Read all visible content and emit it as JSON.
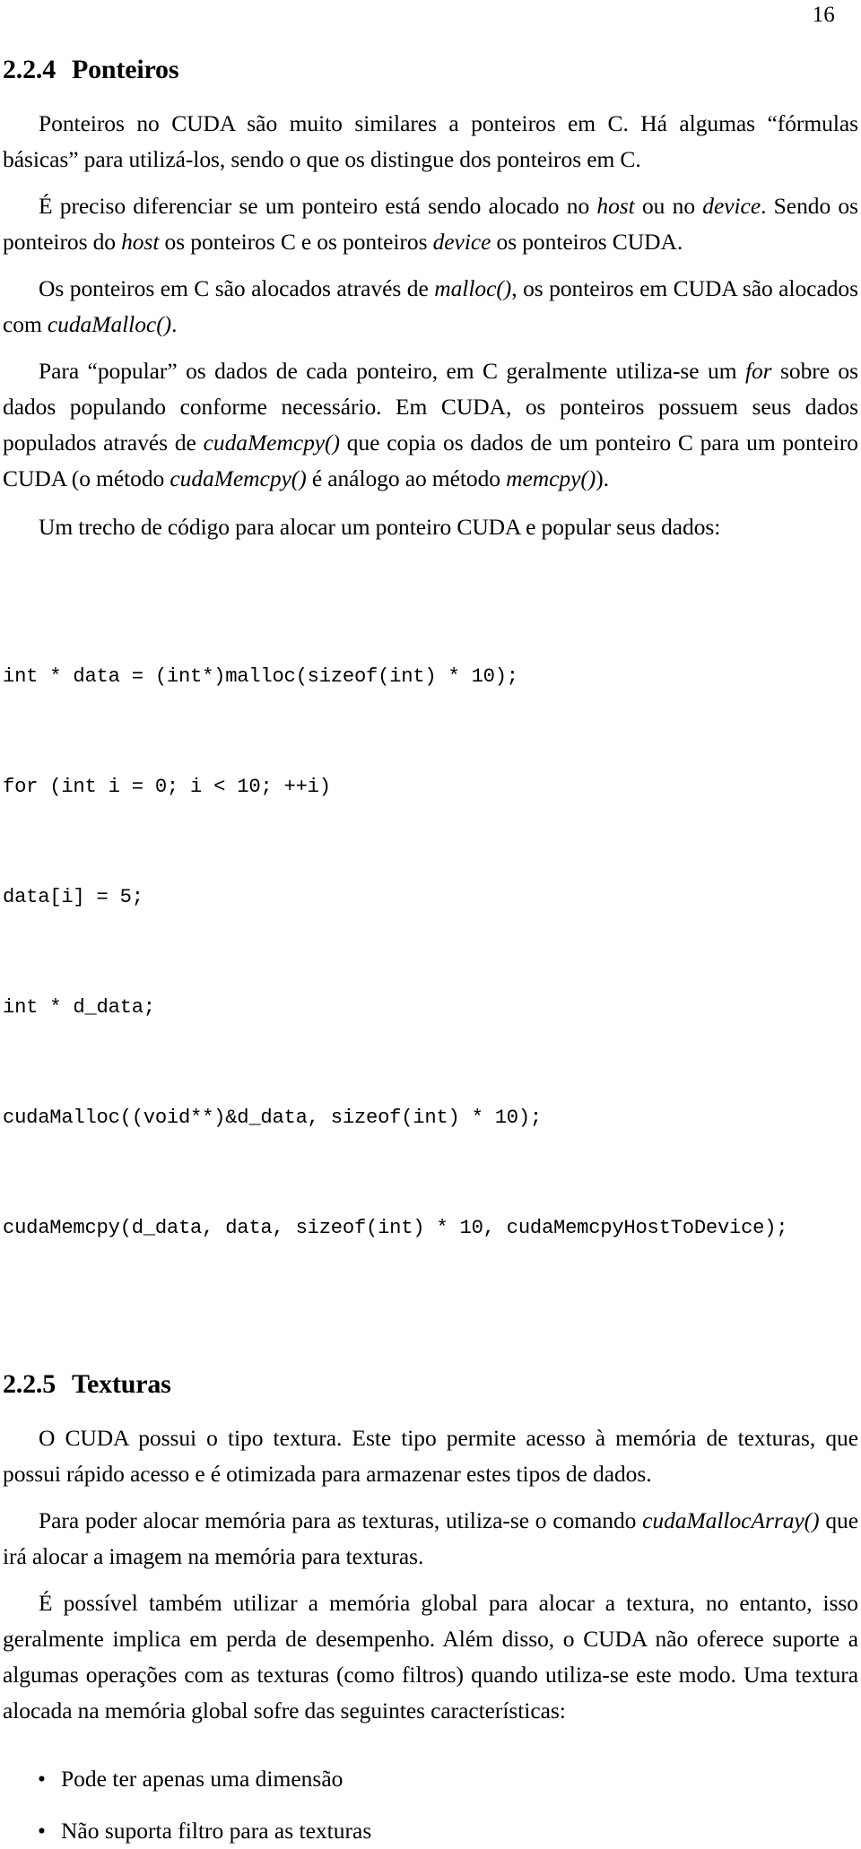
{
  "page": {
    "folio": "16"
  },
  "sections": [
    {
      "number": "2.2.4",
      "title": "Ponteiros"
    },
    {
      "number": "2.2.5",
      "title": "Texturas"
    }
  ],
  "paragraphs": {
    "p1": {
      "a": "Ponteiros no CUDA são muito similares a ponteiros em C. Há algumas “fórmulas básicas” para utilizá-los, sendo o que os distingue dos ponteiros em C."
    },
    "p2": {
      "a": "É preciso diferenciar se um ponteiro está sendo alocado no ",
      "i1": "host",
      "b": " ou no ",
      "i2": "device",
      "c": ". Sendo os ponteiros do ",
      "i3": "host",
      "d": " os ponteiros C e os ponteiros ",
      "i4": "device",
      "e": " os ponteiros CUDA."
    },
    "p3": {
      "a": "Os ponteiros em C são alocados através de ",
      "i1": "malloc()",
      "b": ", os ponteiros em CUDA são alocados com ",
      "i2": "cudaMalloc()",
      "c": "."
    },
    "p4": {
      "a": "Para “popular” os dados de cada ponteiro, em C geralmente utiliza-se um ",
      "i1": "for",
      "b": " sobre os dados populando conforme necessário. Em CUDA, os ponteiros possuem seus dados populados através de ",
      "i2": "cudaMemcpy()",
      "c": " que copia os dados de um ponteiro C para um ponteiro CUDA (o método ",
      "i3": "cudaMemcpy()",
      "d": " é análogo ao método ",
      "i4": "memcpy()",
      "e": ")."
    },
    "p5": {
      "a": "Um trecho de código para alocar um ponteiro CUDA e popular seus dados:"
    },
    "p6": {
      "a": "O CUDA possui o tipo textura. Este tipo permite acesso à memória de texturas, que possui rápido acesso e é otimizada para armazenar estes tipos de dados."
    },
    "p7": {
      "a": "Para poder alocar memória para as texturas, utiliza-se o comando ",
      "i1": "cudaMallocArray()",
      "b": " que irá alocar a imagem na memória para texturas."
    },
    "p8": {
      "a": "É possível também utilizar a memória global para alocar a textura, no entanto, isso geralmente implica em perda de desempenho. Além disso, o CUDA não oferece suporte a algumas operações com as texturas (como filtros) quando utiliza-se este modo. Uma textura alocada na memória global sofre das seguintes características:"
    }
  },
  "code_block": {
    "lines": [
      "int * data = (int*)malloc(sizeof(int) * 10);",
      "for (int i = 0; i < 10; ++i)",
      "data[i] = 5;",
      "int * d_data;",
      "cudaMalloc((void**)&d_data, sizeof(int) * 10);",
      "cudaMemcpy(d_data, data, sizeof(int) * 10, cudaMemcpyHostToDevice);"
    ]
  },
  "bullet_list": {
    "marker": "•",
    "items": [
      "Pode ter apenas uma dimensão",
      "Não suporta filtro para as texturas"
    ]
  }
}
